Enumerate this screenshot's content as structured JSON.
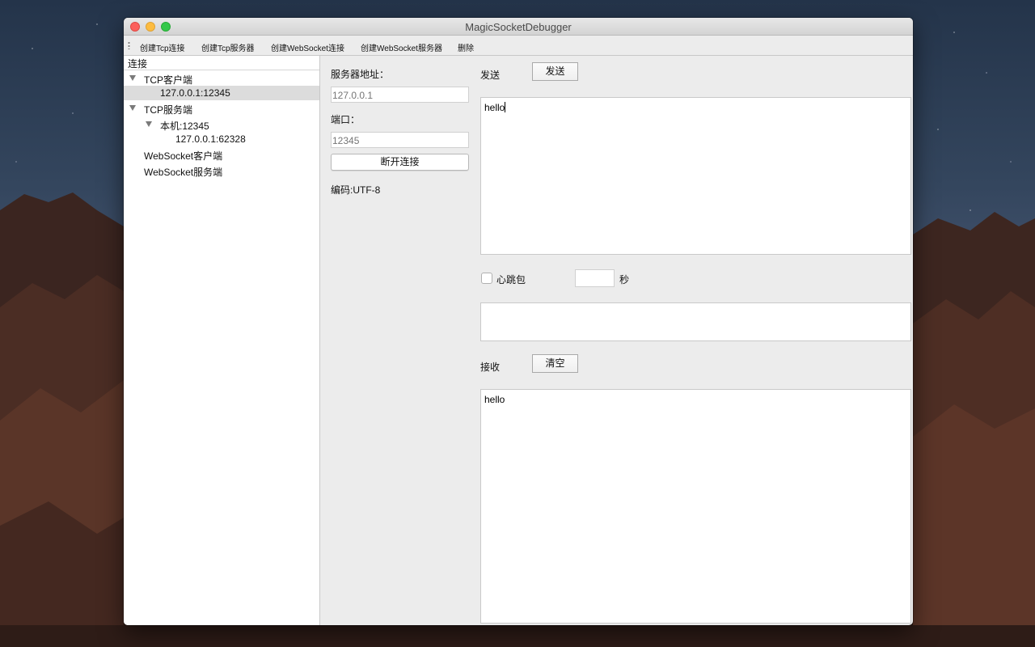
{
  "window": {
    "title": "MagicSocketDebugger"
  },
  "toolbar": {
    "create_tcp_connection": "创建Tcp连接",
    "create_tcp_server": "创建Tcp服务器",
    "create_websocket_connection": "创建WebSocket连接",
    "create_websocket_server": "创建WebSocket服务器",
    "delete": "删除"
  },
  "tree": {
    "header": "连接",
    "items": [
      {
        "label": "TCP客户端",
        "expanded": true
      },
      {
        "label": "127.0.0.1:12345",
        "selected": true
      },
      {
        "label": "TCP服务端",
        "expanded": true
      },
      {
        "label": "本机:12345",
        "expanded": true
      },
      {
        "label": "127.0.0.1:62328"
      },
      {
        "label": "WebSocket客户端"
      },
      {
        "label": "WebSocket服务端"
      }
    ]
  },
  "connection": {
    "server_address_label": "服务器地址：",
    "server_address_placeholder": "127.0.0.1",
    "port_label": "端口：",
    "port_placeholder": "12345",
    "disconnect_label": "断开连接",
    "encoding": "编码:UTF-8"
  },
  "send": {
    "label": "发送",
    "button": "发送",
    "text": "hello"
  },
  "heartbeat": {
    "label": "心跳包",
    "checked": false,
    "interval_value": "",
    "unit": "秒",
    "content": ""
  },
  "receive": {
    "label": "接收",
    "clear_button": "清空",
    "text": "hello"
  }
}
